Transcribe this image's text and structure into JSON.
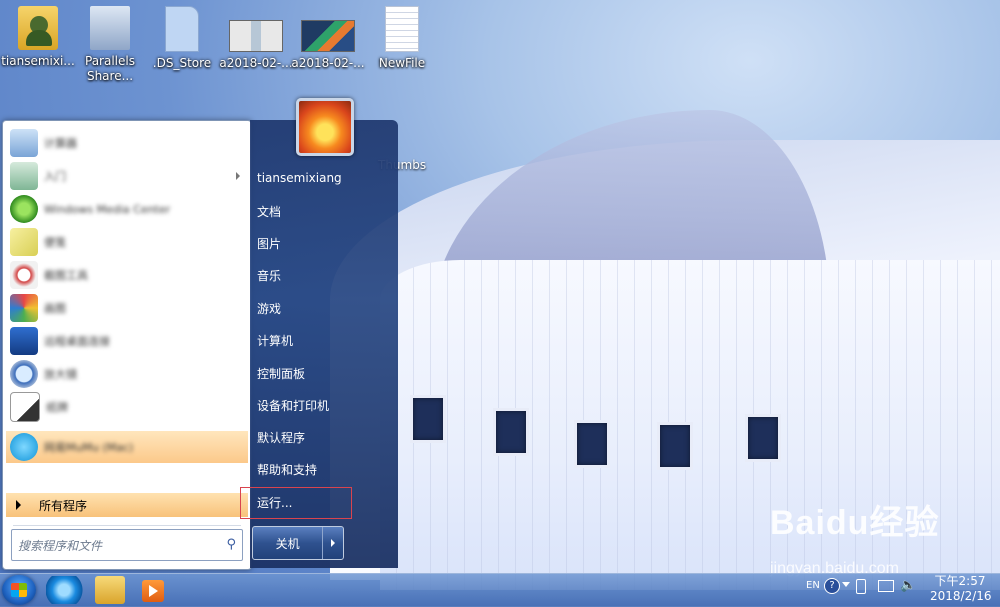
{
  "desktop": {
    "icons": [
      {
        "label": "tiansemixi..."
      },
      {
        "label": "Parallels Share..."
      },
      {
        "label": ".DS_Store"
      },
      {
        "label": "a2018-02-..."
      },
      {
        "label": "a2018-02-..."
      },
      {
        "label": "NewFile"
      }
    ],
    "thumbs_label": "Thumbs"
  },
  "start_menu": {
    "programs": [
      {
        "label": "计算器"
      },
      {
        "label": "入门"
      },
      {
        "label": "Windows Media Center"
      },
      {
        "label": "便笺"
      },
      {
        "label": "截图工具"
      },
      {
        "label": "画图"
      },
      {
        "label": "远程桌面连接"
      },
      {
        "label": "放大镜"
      },
      {
        "label": "纸牌"
      },
      {
        "label": "网易MuMu (Mac)"
      }
    ],
    "all_programs": "所有程序",
    "search_placeholder": "搜索程序和文件",
    "user_name": "tiansemixiang",
    "right_items": [
      "文档",
      "图片",
      "音乐",
      "游戏",
      "计算机",
      "控制面板",
      "设备和打印机",
      "默认程序",
      "帮助和支持",
      "运行..."
    ],
    "shutdown_label": "关机"
  },
  "taskbar": {
    "lang": "EN",
    "time": "下午2:57",
    "date": "2018/2/16"
  },
  "watermark": {
    "brand": "Baidu经验",
    "url": "jingyan.baidu.com"
  }
}
